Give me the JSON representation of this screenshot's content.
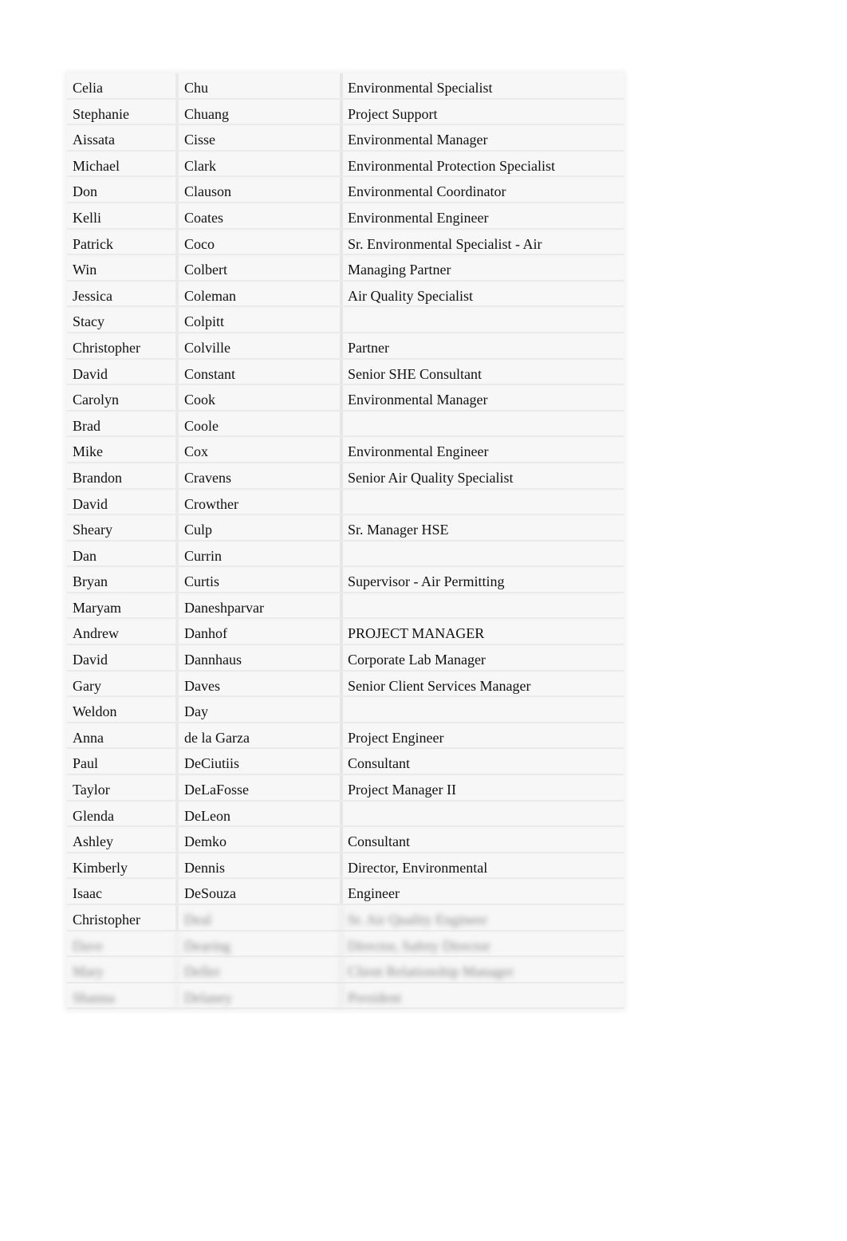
{
  "document": {
    "rows": [
      {
        "first": "Celia",
        "last": "Chu",
        "title": "Environmental Specialist"
      },
      {
        "first": "Stephanie",
        "last": "Chuang",
        "title": "Project Support"
      },
      {
        "first": "Aissata",
        "last": "Cisse",
        "title": "Environmental Manager"
      },
      {
        "first": "Michael",
        "last": "Clark",
        "title": "Environmental Protection Specialist"
      },
      {
        "first": "Don",
        "last": "Clauson",
        "title": "Environmental Coordinator"
      },
      {
        "first": "Kelli",
        "last": "Coates",
        "title": "Environmental Engineer"
      },
      {
        "first": "Patrick",
        "last": "Coco",
        "title": "Sr. Environmental Specialist - Air"
      },
      {
        "first": "Win",
        "last": "Colbert",
        "title": "Managing Partner"
      },
      {
        "first": "Jessica",
        "last": "Coleman",
        "title": "Air Quality Specialist"
      },
      {
        "first": "Stacy",
        "last": "Colpitt",
        "title": ""
      },
      {
        "first": "Christopher",
        "last": "Colville",
        "title": "Partner"
      },
      {
        "first": "David",
        "last": "Constant",
        "title": "Senior SHE Consultant"
      },
      {
        "first": "Carolyn",
        "last": "Cook",
        "title": "Environmental Manager"
      },
      {
        "first": "Brad",
        "last": "Coole",
        "title": ""
      },
      {
        "first": "Mike",
        "last": "Cox",
        "title": "Environmental Engineer"
      },
      {
        "first": "Brandon",
        "last": "Cravens",
        "title": "Senior Air Quality Specialist"
      },
      {
        "first": "David",
        "last": "Crowther",
        "title": ""
      },
      {
        "first": "Sheary",
        "last": "Culp",
        "title": "Sr. Manager HSE"
      },
      {
        "first": "Dan",
        "last": "Currin",
        "title": ""
      },
      {
        "first": "Bryan",
        "last": "Curtis",
        "title": "Supervisor - Air Permitting"
      },
      {
        "first": "Maryam",
        "last": "Daneshparvar",
        "title": ""
      },
      {
        "first": "Andrew",
        "last": "Danhof",
        "title": "PROJECT MANAGER"
      },
      {
        "first": "David",
        "last": "Dannhaus",
        "title": "Corporate Lab Manager"
      },
      {
        "first": "Gary",
        "last": "Daves",
        "title": "Senior Client Services Manager"
      },
      {
        "first": "Weldon",
        "last": "Day",
        "title": ""
      },
      {
        "first": "Anna",
        "last": "de la Garza",
        "title": "Project Engineer"
      },
      {
        "first": "Paul",
        "last": "DeCiutiis",
        "title": "Consultant"
      },
      {
        "first": "Taylor",
        "last": "DeLaFosse",
        "title": "Project Manager II"
      },
      {
        "first": "Glenda",
        "last": "DeLeon",
        "title": ""
      },
      {
        "first": "Ashley",
        "last": "Demko",
        "title": "Consultant"
      },
      {
        "first": "Kimberly",
        "last": "Dennis",
        "title": "Director, Environmental"
      },
      {
        "first": "Isaac",
        "last": "DeSouza",
        "title": "Engineer"
      }
    ],
    "partially_blurred_row": {
      "first": "Christopher",
      "last": "Deal",
      "title": "Sr. Air Quality Engineer"
    },
    "blurred_rows": [
      {
        "first": "Dave",
        "last": "Dearing",
        "title": "Director, Safety Director"
      },
      {
        "first": "Mary",
        "last": "Deller",
        "title": "Client Relationship Manager"
      },
      {
        "first": "Shanna",
        "last": "Delaney",
        "title": "President"
      }
    ]
  }
}
